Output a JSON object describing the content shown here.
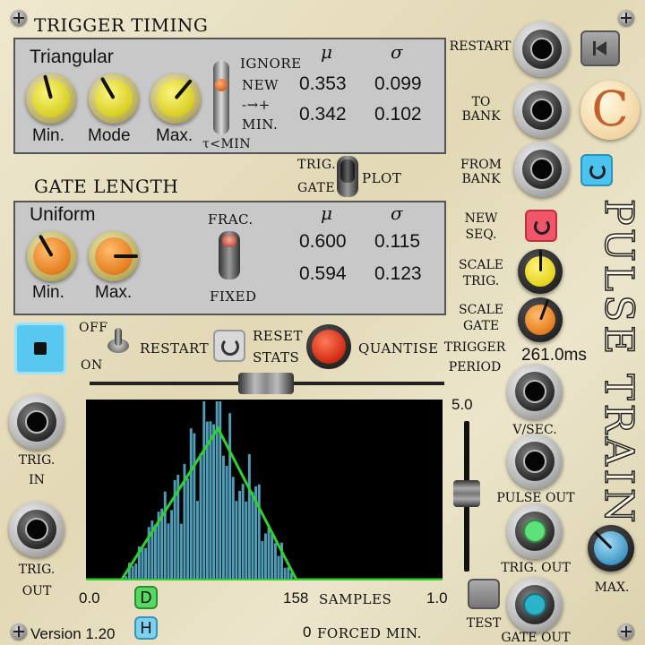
{
  "trigger_timing": {
    "title": "TRIGGER TIMING",
    "distribution": "Triangular",
    "knobs": [
      "Min.",
      "Mode",
      "Max."
    ],
    "mode_switch": [
      "IGNORE",
      "NEW",
      "-→+",
      "MIN."
    ],
    "tau_label": "τ<MIN",
    "mu_label": "μ",
    "sigma_label": "σ",
    "mu_values": [
      "0.353",
      "0.342"
    ],
    "sigma_values": [
      "0.099",
      "0.102"
    ]
  },
  "plot_switch": {
    "top": "TRIG.",
    "bottom": "GATE",
    "right": "PLOT"
  },
  "gate_length": {
    "title": "GATE LENGTH",
    "distribution": "Uniform",
    "knobs": [
      "Min.",
      "Max."
    ],
    "switch_top": "FRAC.",
    "switch_bottom": "FIXED",
    "mu_label": "μ",
    "sigma_label": "σ",
    "mu_values": [
      "0.600",
      "0.594"
    ],
    "sigma_values": [
      "0.115",
      "0.123"
    ]
  },
  "controls": {
    "off_label": "OFF",
    "on_label": "ON",
    "restart_label": "RESTART",
    "reset_stats_line1": "RESET",
    "reset_stats_line2": "STATS",
    "quantise_label": "QUANTISE"
  },
  "right_column": {
    "restart": "RESTART",
    "to_bank": [
      "TO",
      "BANK"
    ],
    "from_bank": [
      "FROM",
      "BANK"
    ],
    "new_seq": [
      "NEW",
      "SEQ."
    ],
    "scale_trig": [
      "SCALE",
      "TRIG."
    ],
    "scale_gate": [
      "SCALE",
      "GATE"
    ],
    "trigger_period": [
      "TRIGGER",
      "PERIOD"
    ],
    "period_value": "261.0ms",
    "v_sec": "V/SEC.",
    "pulse_out": "PULSE OUT",
    "trig_out": "TRIG. OUT",
    "gate_out": "GATE OUT",
    "max_label": "MAX.",
    "test_label": "TEST",
    "module_title": "PULSE TRAIN",
    "logo_letter": "C"
  },
  "left_jacks": {
    "trig_in": [
      "TRIG.",
      "IN"
    ],
    "trig_out": [
      "TRIG.",
      "OUT"
    ]
  },
  "plot": {
    "x_min_label": "0.0",
    "x_max_label": "1.0",
    "y_scale_label": "5.0",
    "samples_count": "158",
    "samples_label": "SAMPLES",
    "forced_count": "0",
    "forced_label": "FORCED MIN.",
    "d_button": "D",
    "h_button": "H",
    "slider_level": 0.42
  },
  "footer": {
    "version": "Version 1.20"
  },
  "colors": {
    "yellow_knob": "#e6df3a",
    "orange_knob": "#e98324",
    "green_jack": "#5ee07a",
    "teal_jack": "#2bb3c9",
    "plot_line": "#2fd12f",
    "histogram": "#5aaecc",
    "stop_button": "#58c8f0"
  }
}
